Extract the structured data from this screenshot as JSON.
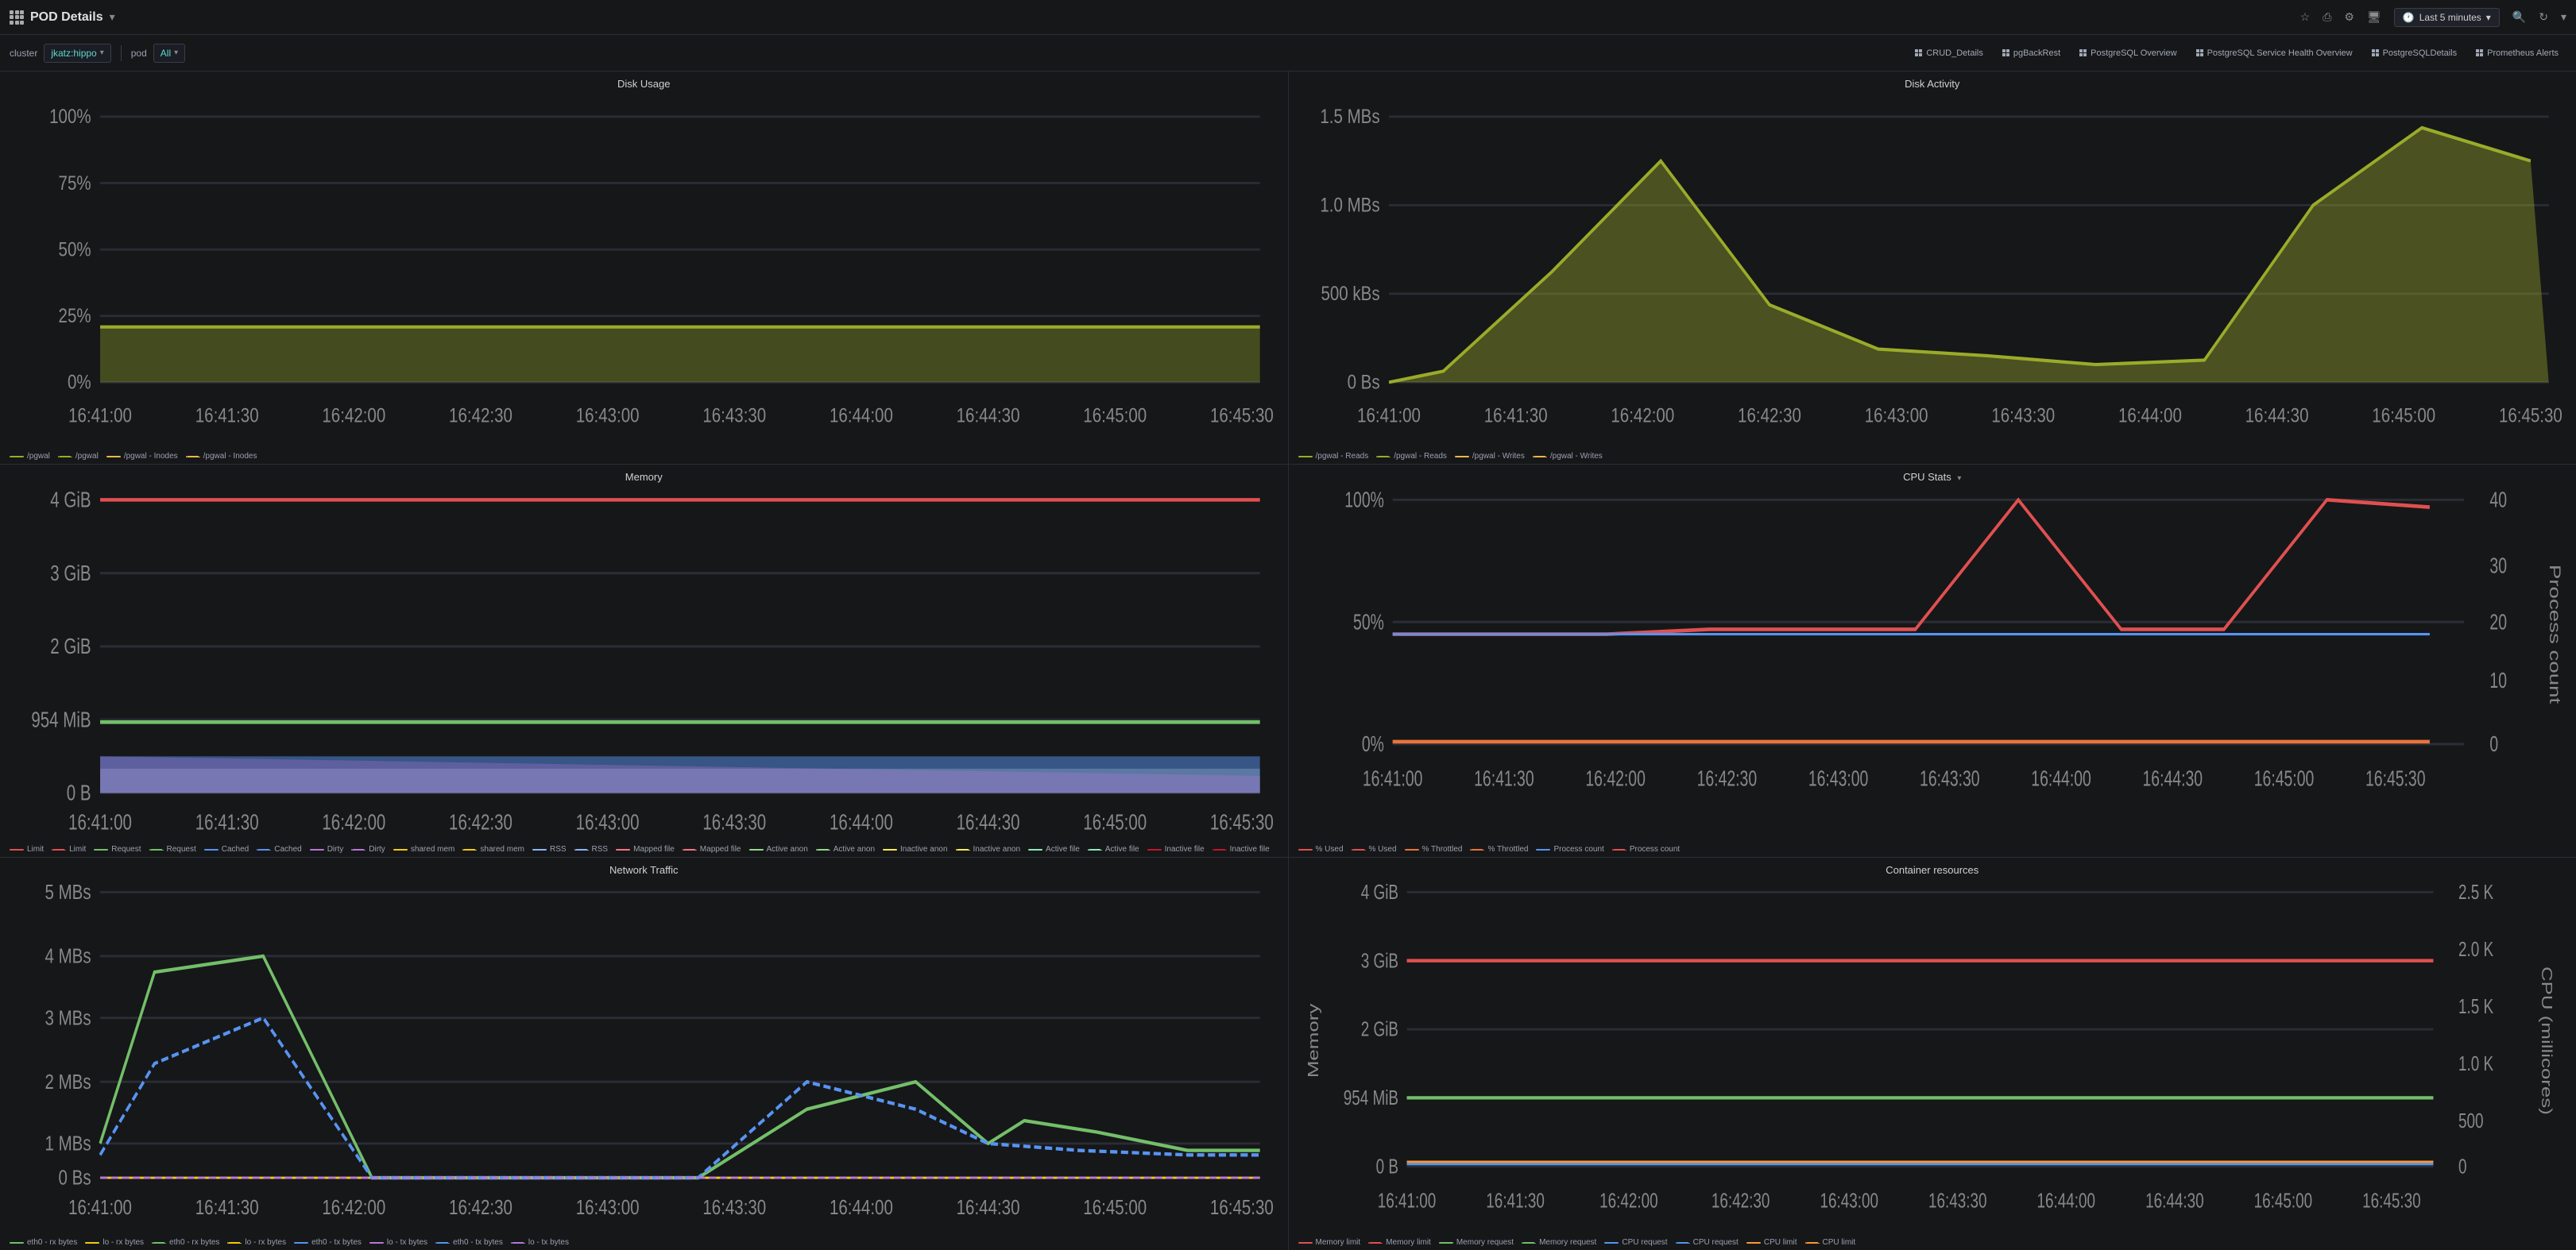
{
  "topbar": {
    "title": "POD Details",
    "title_arrow": "▾",
    "time_range": "Last 5 minutes",
    "icons": {
      "star": "☆",
      "share": "⎙",
      "settings": "⚙",
      "monitor": "⬜",
      "search": "🔍",
      "refresh": "↻",
      "chevron": "▾"
    }
  },
  "filterbar": {
    "cluster_label": "cluster",
    "cluster_value": "jkatz:hippo",
    "pod_label": "pod",
    "pod_value": "All"
  },
  "nav_tabs": [
    {
      "id": "crud",
      "label": "CRUD_Details"
    },
    {
      "id": "pgbackrest",
      "label": "pgBackRest"
    },
    {
      "id": "pg_overview",
      "label": "PostgreSQL Overview"
    },
    {
      "id": "pg_service",
      "label": "PostgreSQL Service Health Overview"
    },
    {
      "id": "pg_details",
      "label": "PostgreSQLDetails"
    },
    {
      "id": "prometheus",
      "label": "Prometheus Alerts"
    }
  ],
  "panels": {
    "disk_usage": {
      "title": "Disk Usage",
      "y_labels": [
        "100%",
        "75%",
        "50%",
        "25%",
        "0%"
      ],
      "x_labels": [
        "16:41:00",
        "16:41:30",
        "16:42:00",
        "16:42:30",
        "16:43:00",
        "16:43:30",
        "16:44:00",
        "16:44:30",
        "16:45:00",
        "16:45:30"
      ],
      "legend": [
        {
          "label": "/pgwal",
          "color": "#9aab2a",
          "dash": false
        },
        {
          "label": "/pgwal",
          "color": "#9aab2a",
          "dash": true
        },
        {
          "label": "/pgwal - Inodes",
          "color": "#e8b84b",
          "dash": false
        },
        {
          "label": "/pgwal - Inodes",
          "color": "#e8b84b",
          "dash": true
        }
      ]
    },
    "disk_activity": {
      "title": "Disk Activity",
      "y_labels": [
        "1.5 MBs",
        "1.0 MBs",
        "500 kBs",
        "0 Bs"
      ],
      "x_labels": [
        "16:41:00",
        "16:41:30",
        "16:42:00",
        "16:42:30",
        "16:43:00",
        "16:43:30",
        "16:44:00",
        "16:44:30",
        "16:45:00",
        "16:45:30"
      ],
      "legend": [
        {
          "label": "/pgwal - Reads",
          "color": "#9aab2a",
          "dash": false
        },
        {
          "label": "/pgwal - Reads",
          "color": "#9aab2a",
          "dash": true
        },
        {
          "label": "/pgwal - Writes",
          "color": "#e8b84b",
          "dash": false
        },
        {
          "label": "/pgwal - Writes",
          "color": "#e8b84b",
          "dash": true
        }
      ]
    },
    "memory": {
      "title": "Memory",
      "y_labels": [
        "4 GiB",
        "3 GiB",
        "2 GiB",
        "954 MiB",
        "0 B"
      ],
      "x_labels": [
        "16:41:00",
        "16:41:30",
        "16:42:00",
        "16:42:30",
        "16:43:00",
        "16:43:30",
        "16:44:00",
        "16:44:30",
        "16:45:00",
        "16:45:30"
      ],
      "legend": [
        {
          "label": "Limit",
          "color": "#e05050",
          "dash": false
        },
        {
          "label": "Limit",
          "color": "#e05050",
          "dash": true
        },
        {
          "label": "Request",
          "color": "#73bf69",
          "dash": false
        },
        {
          "label": "Request",
          "color": "#73bf69",
          "dash": true
        },
        {
          "label": "Cached",
          "color": "#5794f2",
          "dash": false
        },
        {
          "label": "Cached",
          "color": "#5794f2",
          "dash": true
        },
        {
          "label": "Dirty",
          "color": "#b877d9",
          "dash": false
        },
        {
          "label": "Dirty",
          "color": "#b877d9",
          "dash": true
        },
        {
          "label": "shared mem",
          "color": "#f2cc0c",
          "dash": false
        },
        {
          "label": "shared mem",
          "color": "#f2cc0c",
          "dash": true
        },
        {
          "label": "RSS",
          "color": "#8ab8ff",
          "dash": false
        },
        {
          "label": "RSS",
          "color": "#8ab8ff",
          "dash": true
        },
        {
          "label": "Mapped file",
          "color": "#ff7383",
          "dash": false
        },
        {
          "label": "Mapped file",
          "color": "#ff7383",
          "dash": true
        },
        {
          "label": "Active anon",
          "color": "#96d98d",
          "dash": false
        },
        {
          "label": "Active anon",
          "color": "#96d98d",
          "dash": true
        },
        {
          "label": "Inactive anon",
          "color": "#ffee52",
          "dash": false
        },
        {
          "label": "Inactive anon",
          "color": "#ffee52",
          "dash": true
        },
        {
          "label": "Active file",
          "color": "#8cebbe",
          "dash": false
        },
        {
          "label": "Active file",
          "color": "#8cebbe",
          "dash": true
        },
        {
          "label": "Inactive file",
          "color": "#c4162a",
          "dash": false
        },
        {
          "label": "Inactive file",
          "color": "#c4162a",
          "dash": true
        }
      ]
    },
    "cpu_stats": {
      "title": "CPU Stats",
      "y_labels_left": [
        "100%",
        "50%",
        "0%"
      ],
      "y_labels_right": [
        "40",
        "30",
        "20",
        "10",
        "0"
      ],
      "right_axis_label": "Process count",
      "x_labels": [
        "16:41:00",
        "16:41:30",
        "16:42:00",
        "16:42:30",
        "16:43:00",
        "16:43:30",
        "16:44:00",
        "16:44:30",
        "16:45:00",
        "16:45:30"
      ],
      "legend": [
        {
          "label": "% Used",
          "color": "#e05050",
          "dash": false
        },
        {
          "label": "% Used",
          "color": "#e05050",
          "dash": true
        },
        {
          "label": "% Throttled",
          "color": "#e8743b",
          "dash": false
        },
        {
          "label": "% Throttled",
          "color": "#e8743b",
          "dash": true
        },
        {
          "label": "Process count",
          "color": "#5794f2",
          "dash": false
        },
        {
          "label": "Process count",
          "color": "#e05050",
          "dash": true
        }
      ]
    },
    "network_traffic": {
      "title": "Network Traffic",
      "y_labels": [
        "5 MBs",
        "4 MBs",
        "3 MBs",
        "2 MBs",
        "1 MBs",
        "0 Bs"
      ],
      "x_labels": [
        "16:41:00",
        "16:41:30",
        "16:42:00",
        "16:42:30",
        "16:43:00",
        "16:43:30",
        "16:44:00",
        "16:44:30",
        "16:45:00",
        "16:45:30"
      ],
      "legend": [
        {
          "label": "eth0 - rx bytes",
          "color": "#73bf69",
          "dash": false
        },
        {
          "label": "lo - rx bytes",
          "color": "#f2cc0c",
          "dash": false
        },
        {
          "label": "eth0 - rx bytes",
          "color": "#73bf69",
          "dash": true
        },
        {
          "label": "lo - rx bytes",
          "color": "#f2cc0c",
          "dash": true
        },
        {
          "label": "eth0 - tx bytes",
          "color": "#5794f2",
          "dash": false
        },
        {
          "label": "lo - tx bytes",
          "color": "#b877d9",
          "dash": false
        },
        {
          "label": "eth0 - tx bytes",
          "color": "#5794f2",
          "dash": true
        },
        {
          "label": "lo - tx bytes",
          "color": "#b877d9",
          "dash": true
        }
      ]
    },
    "container_resources": {
      "title": "Container resources",
      "y_labels_left": [
        "4 GiB",
        "3 GiB",
        "2 GiB",
        "954 MiB",
        "0 B"
      ],
      "y_labels_right": [
        "2.5 K",
        "2.0 K",
        "1.5 K",
        "1.0 K",
        "500",
        "0"
      ],
      "right_axis_label": "CPU (millicores)",
      "left_axis_label": "Memory",
      "x_labels": [
        "16:41:00",
        "16:41:30",
        "16:42:00",
        "16:42:30",
        "16:43:00",
        "16:43:30",
        "16:44:00",
        "16:44:30",
        "16:45:00",
        "16:45:30"
      ],
      "legend": [
        {
          "label": "Memory limit",
          "color": "#e05050",
          "dash": false
        },
        {
          "label": "Memory limit",
          "color": "#e05050",
          "dash": true
        },
        {
          "label": "Memory request",
          "color": "#73bf69",
          "dash": false
        },
        {
          "label": "Memory request",
          "color": "#73bf69",
          "dash": true
        },
        {
          "label": "CPU request",
          "color": "#5794f2",
          "dash": false
        },
        {
          "label": "CPU request",
          "color": "#5794f2",
          "dash": true
        },
        {
          "label": "CPU limit",
          "color": "#ff9830",
          "dash": false
        },
        {
          "label": "CPU limit",
          "color": "#ff9830",
          "dash": true
        }
      ]
    }
  }
}
